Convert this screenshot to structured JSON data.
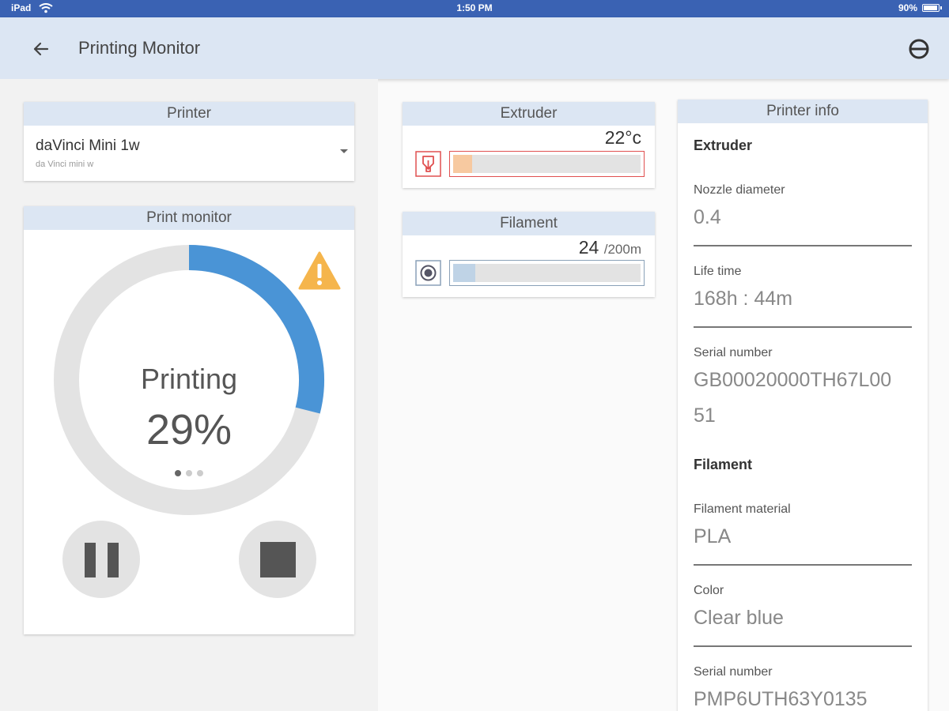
{
  "statusbar": {
    "device": "iPad",
    "time": "1:50 PM",
    "battery": "90%"
  },
  "appbar": {
    "title": "Printing Monitor",
    "back_icon": "arrow-left-icon",
    "menu_icon": "circle-minus-icon"
  },
  "printer": {
    "header": "Printer",
    "selected_name": "daVinci Mini 1w",
    "selected_subtitle": "da Vinci mini w"
  },
  "monitor": {
    "header": "Print monitor",
    "status": "Printing",
    "percent_label": "29%",
    "progress": 0.29,
    "page_dots": 3,
    "active_dot": 0,
    "warning_icon": "warning-icon",
    "colors": {
      "track": "#e3e3e3",
      "progress": "#4a94d6",
      "warning": "#f5b54c"
    }
  },
  "extruder": {
    "header": "Extruder",
    "temperature_label": "22°c",
    "level": 0.1,
    "icon": "nozzle-icon",
    "colors": {
      "accent": "#e05050",
      "fill": "#f7c9a0"
    }
  },
  "filament": {
    "header": "Filament",
    "used": "24",
    "total": "/200m",
    "level": 0.12,
    "icon": "spool-icon",
    "colors": {
      "fill": "#bfd3e6"
    }
  },
  "info": {
    "header": "Printer info",
    "extruder_title": "Extruder",
    "nozzle_label": "Nozzle diameter",
    "nozzle_value": "0.4",
    "lifetime_label": "Life time",
    "lifetime_value": "168h : 44m",
    "serial_label": "Serial number",
    "serial_value_line1": "GB00020000TH67L00",
    "serial_value_line2": "51",
    "filament_title": "Filament",
    "material_label": "Filament material",
    "material_value": "PLA",
    "color_label": "Color",
    "color_value": "Clear blue",
    "fil_serial_label": "Serial number",
    "fil_serial_value": "PMP6UTH63Y0135"
  }
}
